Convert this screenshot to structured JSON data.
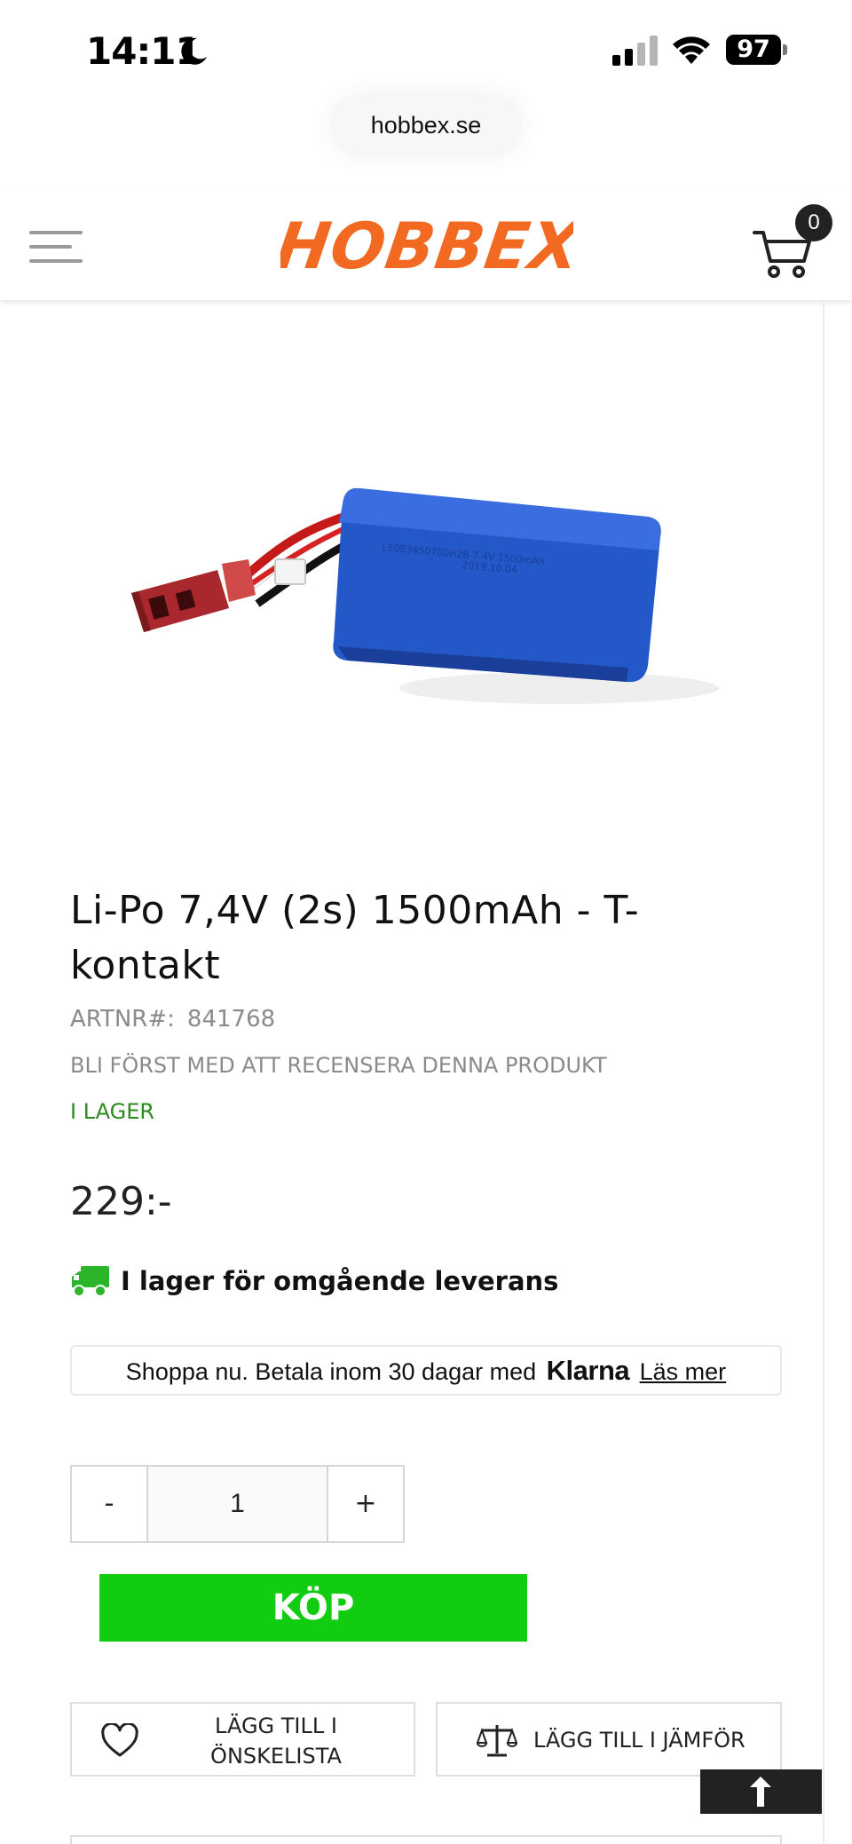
{
  "status_bar": {
    "time": "14:11",
    "battery": "97",
    "icons": [
      "moon-icon",
      "signal-icon",
      "wifi-icon",
      "battery-icon"
    ]
  },
  "browser": {
    "url": "hobbex.se"
  },
  "header": {
    "logo_text": "HOBBEX",
    "cart_count": "0",
    "icons": [
      "menu-icon",
      "cart-icon"
    ],
    "brand_color": "#f26a21"
  },
  "product": {
    "title": "Li-Po 7,4V (2s) 1500mAh - T-kontakt",
    "artnr_label": "ARTNR#:",
    "artnr_value": "841768",
    "review_link": "BLI FÖRST MED ATT RECENSERA DENNA PRODUKT",
    "stock_status": "I LAGER",
    "price": "229:-",
    "delivery_text": "I lager för omgående leverans"
  },
  "klarna": {
    "text": "Shoppa nu. Betala inom 30 dagar med",
    "logo": "Klarna",
    "link": "Läs mer"
  },
  "quantity": {
    "minus": "-",
    "value": "1",
    "plus": "+"
  },
  "actions": {
    "buy": "KÖP",
    "wishlist": "LÄGG TILL I ÖNSKELISTA",
    "compare": "LÄGG TILL I JÄMFÖR",
    "buy_color": "#11cc11"
  },
  "colors": {
    "stock_green": "#2c8a1f",
    "battery_blue": "#2458c8"
  }
}
